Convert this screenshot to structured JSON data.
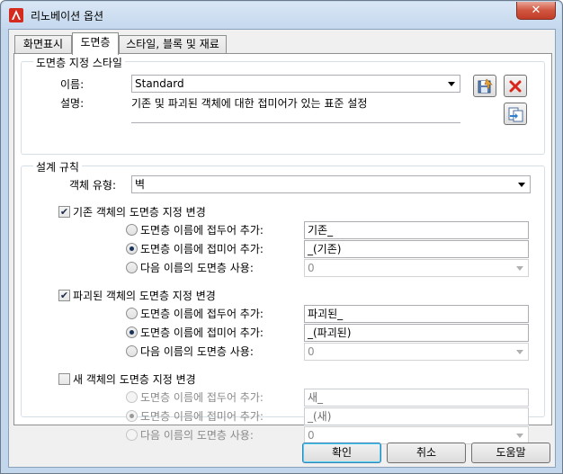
{
  "window": {
    "title": "리노베이션 옵션",
    "close_symbol": "✕"
  },
  "tabs": [
    {
      "label": "화면표시"
    },
    {
      "label": "도면층"
    },
    {
      "label": "스타일, 블록 및 재료"
    }
  ],
  "layer_style": {
    "group_title": "도면층 지정 스타일",
    "name_label": "이름:",
    "name_value": "Standard",
    "desc_label": "설명:",
    "desc_value": "기존 및 파괴된 객체에 대한 접미어가 있는 표준 설정"
  },
  "design_rules": {
    "group_title": "설계 규칙",
    "object_type_label": "객체 유형:",
    "object_type_value": "벽",
    "sections": [
      {
        "title": "기존 객체의 도면층 지정 변경",
        "checked": true,
        "options": [
          {
            "label": "도면층 이름에 접두어 추가:",
            "value": "기존_",
            "selected": false
          },
          {
            "label": "도면층 이름에 접미어 추가:",
            "value": "_(기존)",
            "selected": true
          },
          {
            "label": "다음 이름의 도면층 사용:",
            "value": "0",
            "selected": false
          }
        ]
      },
      {
        "title": "파괴된 객체의 도면층 지정 변경",
        "checked": true,
        "options": [
          {
            "label": "도면층 이름에 접두어 추가:",
            "value": "파괴된_",
            "selected": false
          },
          {
            "label": "도면층 이름에 접미어 추가:",
            "value": "_(파괴된)",
            "selected": true
          },
          {
            "label": "다음 이름의 도면층 사용:",
            "value": "0",
            "selected": false
          }
        ]
      },
      {
        "title": "새 객체의 도면층 지정 변경",
        "checked": false,
        "options": [
          {
            "label": "도면층 이름에 접두어 추가:",
            "value": "새_",
            "selected": false
          },
          {
            "label": "도면층 이름에 접미어 추가:",
            "value": "_(새)",
            "selected": true
          },
          {
            "label": "다음 이름의 도면층 사용:",
            "value": "0",
            "selected": false
          }
        ]
      }
    ]
  },
  "buttons": {
    "ok": "확인",
    "cancel": "취소",
    "help": "도움말"
  },
  "icons": [
    "autocad-app-icon",
    "save-icon",
    "delete-icon",
    "import-icon",
    "checkbox-check-icon"
  ],
  "colors": {
    "title_bar": "#c5d8ee",
    "close_button": "#c13d28",
    "delete_x": "#d9261c"
  }
}
